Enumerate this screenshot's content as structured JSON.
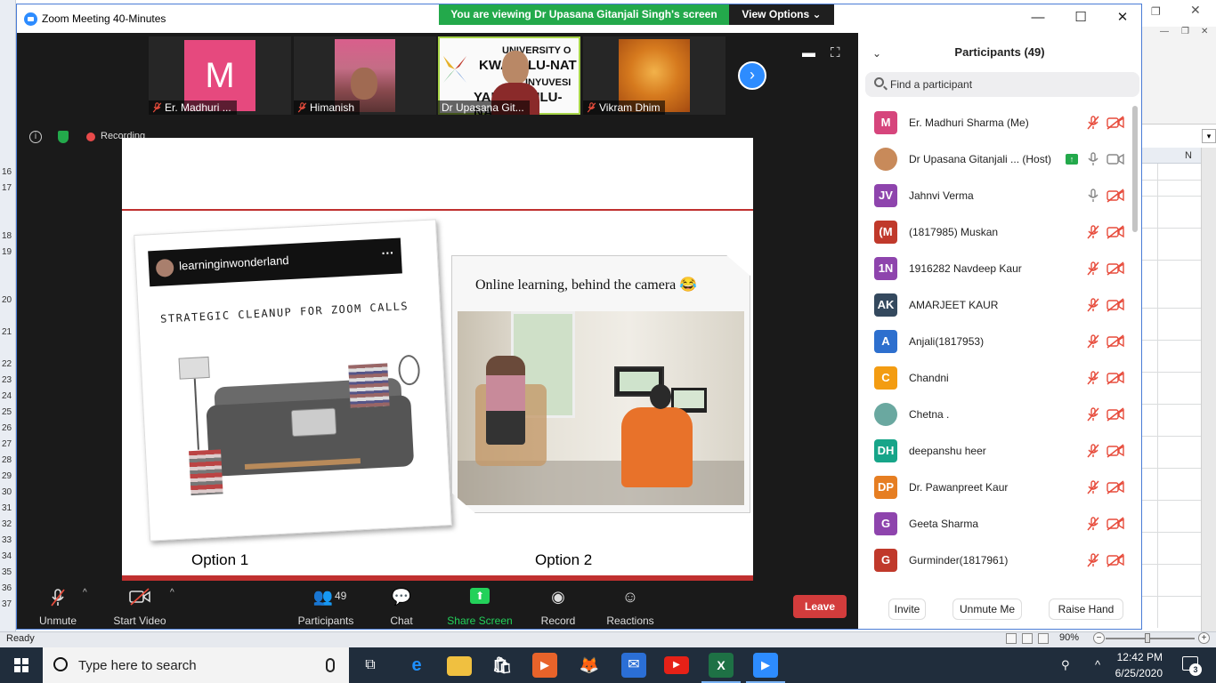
{
  "zoom": {
    "window_title": "Zoom Meeting 40-Minutes",
    "viewing_banner": "You are viewing Dr Upasana Gitanjali Singh's screen",
    "view_options": "View Options",
    "recording": "Recording",
    "tiles": [
      {
        "name": "Er. Madhuri ...",
        "initial": "M",
        "color": "#e6497e"
      },
      {
        "name": "Himanish"
      },
      {
        "name": "Dr Upasana Git..."
      },
      {
        "name": "Vikram Dhim"
      }
    ],
    "university_lines": [
      "UNIVERSITY O",
      "KWAZULU-NAT",
      "INYUVESI",
      "YAKWAZULU-NA"
    ]
  },
  "slide": {
    "insta_handle": "learninginwonderland",
    "cleanup_title": "STRATEGIC CLEANUP FOR ZOOM CALLS",
    "caption2": "Online learning, behind the camera 😂",
    "option1": "Option 1",
    "option2": "Option 2"
  },
  "toolbar": {
    "unmute": "Unmute",
    "start_video": "Start Video",
    "participants": "Participants",
    "participants_count": "49",
    "chat": "Chat",
    "share_screen": "Share Screen",
    "record": "Record",
    "reactions": "Reactions",
    "leave": "Leave"
  },
  "panel": {
    "title": "Participants (49)",
    "search_placeholder": "Find a participant",
    "participants": [
      {
        "initials": "M",
        "name": "Er. Madhuri Sharma (Me)",
        "color": "#d6457c",
        "mic": "muted",
        "cam": "off"
      },
      {
        "initials": "",
        "name": "Dr Upasana Gitanjali ... (Host)",
        "color": "#c88a5a",
        "mic": "on",
        "cam": "on",
        "sharing": true
      },
      {
        "initials": "JV",
        "name": "Jahnvi Verma",
        "color": "#8e44ad",
        "mic": "on",
        "cam": "off"
      },
      {
        "initials": "(M",
        "name": "(1817985) Muskan",
        "color": "#c0392b",
        "mic": "muted",
        "cam": "off"
      },
      {
        "initials": "1N",
        "name": "1916282 Navdeep Kaur",
        "color": "#8e44ad",
        "mic": "muted",
        "cam": "off"
      },
      {
        "initials": "AK",
        "name": "AMARJEET KAUR",
        "color": "#34495e",
        "mic": "muted",
        "cam": "off"
      },
      {
        "initials": "A",
        "name": "Anjali(1817953)",
        "color": "#2d6fce",
        "mic": "muted",
        "cam": "off"
      },
      {
        "initials": "C",
        "name": "Chandni",
        "color": "#f39c12",
        "mic": "muted",
        "cam": "off"
      },
      {
        "initials": "",
        "name": "Chetna .",
        "color": "#6aa8a0",
        "mic": "muted",
        "cam": "off"
      },
      {
        "initials": "DH",
        "name": "deepanshu heer",
        "color": "#17a589",
        "mic": "muted",
        "cam": "off"
      },
      {
        "initials": "DP",
        "name": "Dr. Pawanpreet Kaur",
        "color": "#e67e22",
        "mic": "muted",
        "cam": "off"
      },
      {
        "initials": "G",
        "name": "Geeta Sharma",
        "color": "#8e44ad",
        "mic": "muted",
        "cam": "off"
      },
      {
        "initials": "G",
        "name": "Gurminder(1817961)",
        "color": "#c0392b",
        "mic": "muted",
        "cam": "off"
      }
    ],
    "invite": "Invite",
    "unmute_me": "Unmute Me",
    "raise_hand": "Raise Hand"
  },
  "excel": {
    "status": "Ready",
    "zoom_level": "90%",
    "column_label": "N",
    "row_numbers": [
      "16",
      "17",
      "18",
      "19",
      "20",
      "21",
      "22",
      "23",
      "24",
      "25",
      "26",
      "27",
      "28",
      "29",
      "30",
      "31",
      "32",
      "33",
      "34",
      "35",
      "36",
      "37"
    ]
  },
  "taskbar": {
    "search_placeholder": "Type here to search",
    "time": "12:42 PM",
    "date": "6/25/2020",
    "notifications": "3"
  },
  "colors": {
    "zoom_blue": "#2d8cff",
    "banner_green": "#23a94b",
    "leave_red": "#d33c3c",
    "slide_accent": "#c0302f"
  }
}
